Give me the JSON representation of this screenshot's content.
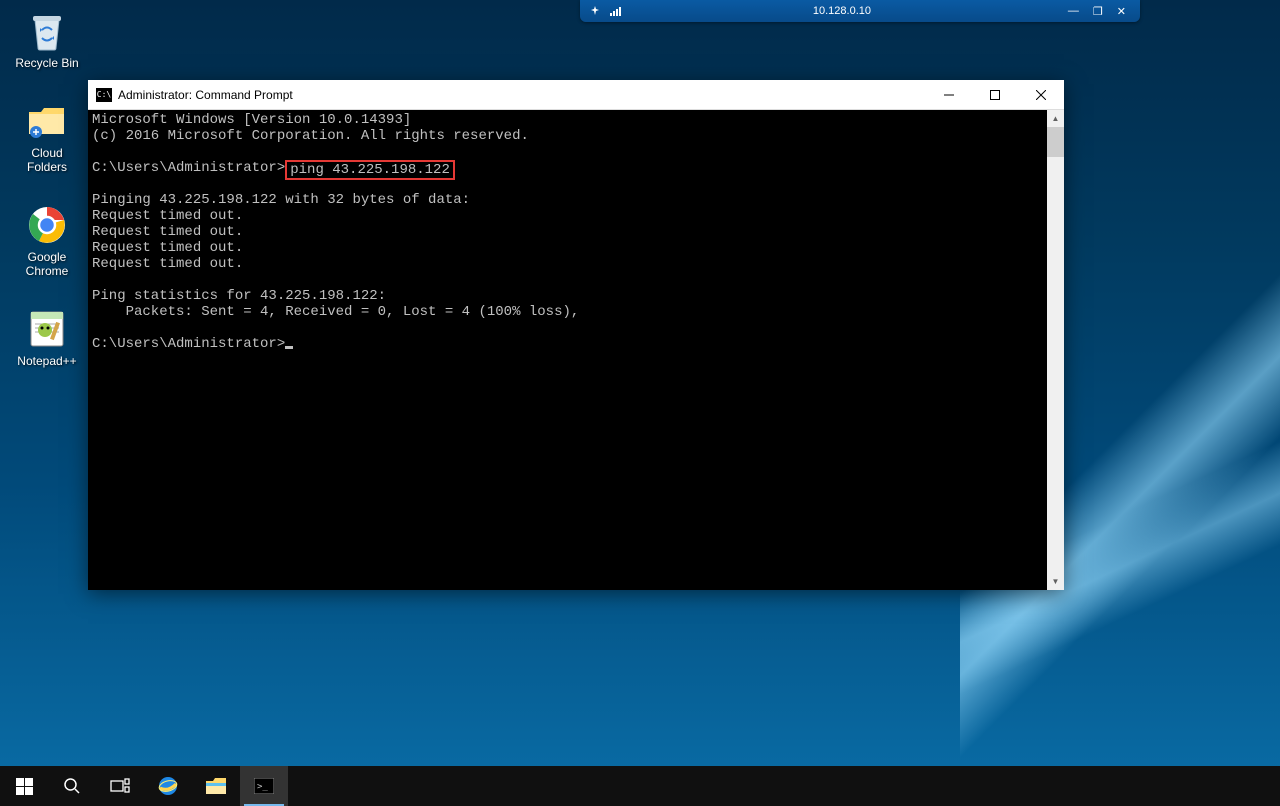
{
  "remote_bar": {
    "ip": "10.128.0.10"
  },
  "desktop": {
    "icons": [
      {
        "label": "Recycle Bin"
      },
      {
        "label": "Cloud Folders"
      },
      {
        "label": "Google Chrome"
      },
      {
        "label": "Notepad++"
      }
    ]
  },
  "cmd": {
    "title": "Administrator: Command Prompt",
    "lines": {
      "header1": "Microsoft Windows [Version 10.0.14393]",
      "header2": "(c) 2016 Microsoft Corporation. All rights reserved.",
      "prompt1_prefix": "C:\\Users\\Administrator>",
      "command": "ping 43.225.198.122",
      "pinging": "Pinging 43.225.198.122 with 32 bytes of data:",
      "timeout1": "Request timed out.",
      "timeout2": "Request timed out.",
      "timeout3": "Request timed out.",
      "timeout4": "Request timed out.",
      "stats_header": "Ping statistics for 43.225.198.122:",
      "stats_packets": "    Packets: Sent = 4, Received = 0, Lost = 4 (100% loss),",
      "prompt2": "C:\\Users\\Administrator>"
    }
  }
}
